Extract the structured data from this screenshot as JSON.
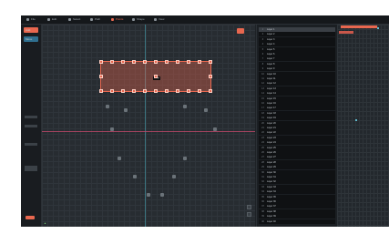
{
  "toolbar": {
    "items": [
      {
        "label": "File",
        "icon": "file-icon"
      },
      {
        "label": "Edit",
        "icon": "edit-icon"
      },
      {
        "label": "Select",
        "icon": "select-icon"
      },
      {
        "label": "Path",
        "icon": "path-icon"
      },
      {
        "label": "Points",
        "icon": "points-icon"
      },
      {
        "label": "Shape",
        "icon": "shape-icon"
      },
      {
        "label": "View",
        "icon": "view-icon"
      }
    ],
    "active_item": "Points",
    "accent_color": "#e8674f"
  },
  "sidebar": {
    "buttons": [
      {
        "label": "Add",
        "color": "#e8674f"
      },
      {
        "label": "Move",
        "color": "#2f6f8f"
      }
    ]
  },
  "canvas": {
    "selection_tag": "Group"
  },
  "layers": {
    "rows": [
      {
        "num": "1",
        "label": "Layer 1"
      },
      {
        "num": "2",
        "label": "Layer 2"
      },
      {
        "num": "3",
        "label": "Layer 3"
      },
      {
        "num": "4",
        "label": "Layer 4"
      },
      {
        "num": "5",
        "label": "Layer 5"
      },
      {
        "num": "6",
        "label": "Layer 6"
      },
      {
        "num": "7",
        "label": "Layer 7"
      },
      {
        "num": "8",
        "label": "Layer 8"
      },
      {
        "num": "9",
        "label": "Layer 9"
      },
      {
        "num": "10",
        "label": "Layer 10"
      },
      {
        "num": "11",
        "label": "Layer 11"
      },
      {
        "num": "12",
        "label": "Layer 12"
      },
      {
        "num": "13",
        "label": "Layer 13"
      },
      {
        "num": "14",
        "label": "Layer 14"
      },
      {
        "num": "15",
        "label": "Layer 15"
      },
      {
        "num": "16",
        "label": "Layer 16"
      },
      {
        "num": "17",
        "label": "Layer 17"
      },
      {
        "num": "18",
        "label": "Layer 18"
      },
      {
        "num": "19",
        "label": "Layer 19"
      },
      {
        "num": "20",
        "label": "Layer 20"
      },
      {
        "num": "21",
        "label": "Layer 21"
      },
      {
        "num": "22",
        "label": "Layer 22"
      },
      {
        "num": "23",
        "label": "Layer 23"
      },
      {
        "num": "24",
        "label": "Layer 24"
      },
      {
        "num": "25",
        "label": "Layer 25"
      },
      {
        "num": "26",
        "label": "Layer 26"
      },
      {
        "num": "27",
        "label": "Layer 27"
      },
      {
        "num": "28",
        "label": "Layer 28"
      },
      {
        "num": "29",
        "label": "Layer 29"
      },
      {
        "num": "30",
        "label": "Layer 30"
      },
      {
        "num": "31",
        "label": "Layer 31"
      },
      {
        "num": "32",
        "label": "Layer 32"
      },
      {
        "num": "33",
        "label": "Layer 33"
      },
      {
        "num": "34",
        "label": "Layer 34"
      },
      {
        "num": "35",
        "label": "Layer 35"
      },
      {
        "num": "36",
        "label": "Layer 36"
      },
      {
        "num": "37",
        "label": "Layer 37"
      },
      {
        "num": "38",
        "label": "Layer 38"
      },
      {
        "num": "39",
        "label": "Layer 39"
      },
      {
        "num": "40",
        "label": "Layer 40"
      }
    ]
  },
  "timeline": {
    "keyframe_color": "#e8674f"
  }
}
